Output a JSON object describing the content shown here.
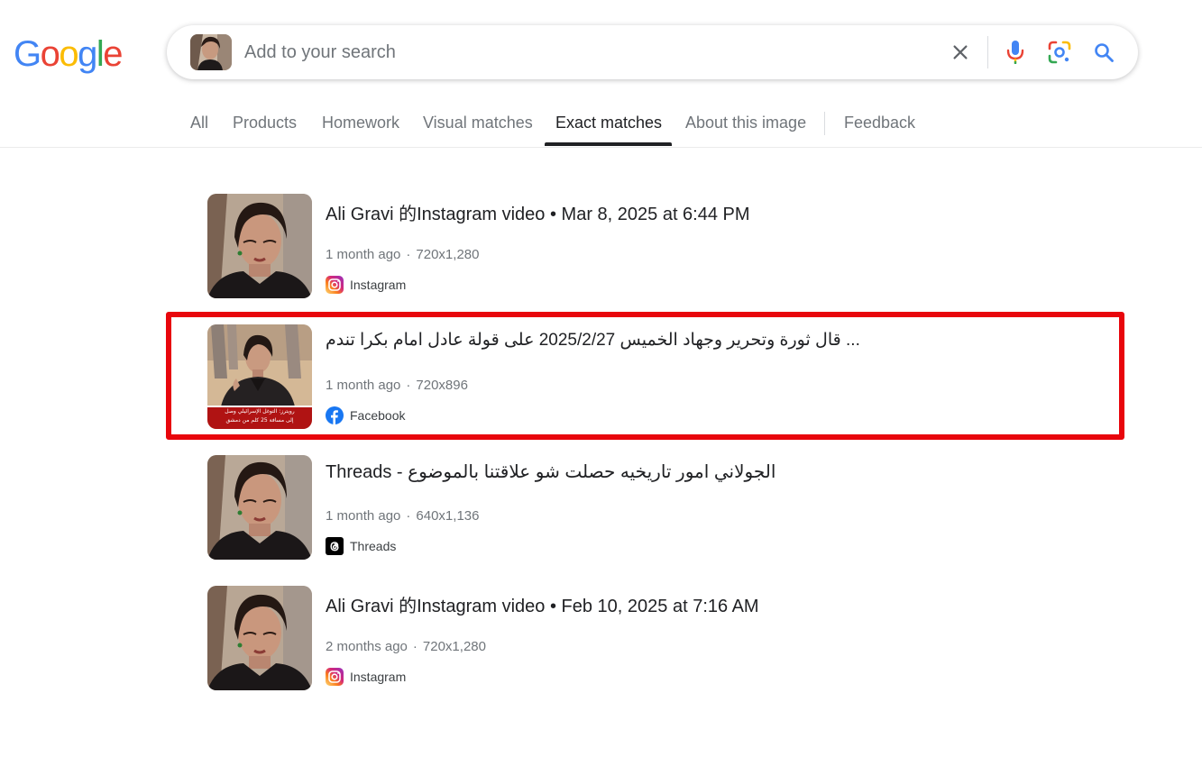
{
  "logo": {
    "letters": [
      "G",
      "o",
      "o",
      "g",
      "l",
      "e"
    ],
    "colors": [
      "#4285F4",
      "#EA4335",
      "#FBBC05",
      "#4285F4",
      "#34A853",
      "#EA4335"
    ]
  },
  "search": {
    "placeholder": "Add to your search",
    "value": ""
  },
  "tabs": [
    {
      "label": "All"
    },
    {
      "label": "Products"
    },
    {
      "label": "Homework"
    },
    {
      "label": "Visual matches"
    },
    {
      "label": "Exact matches",
      "active": true
    },
    {
      "label": "About this image"
    },
    {
      "label": "Feedback"
    }
  ],
  "results": [
    {
      "title": "Ali Gravi 的Instagram video • Mar 8, 2025 at 6:44 PM",
      "age": "1 month ago",
      "dimensions": "720x1,280",
      "source": "Instagram",
      "source_icon": "instagram-icon"
    },
    {
      "title": "قال ثورة وتحرير وجهاد الخميس 2025/2/27 على قولة عادل امام بكرا تندم ...",
      "age": "1 month ago",
      "dimensions": "720x896",
      "source": "Facebook",
      "source_icon": "facebook-icon",
      "highlighted": true,
      "thumb_caption_line1": "رويترز: التوغل الإسرائيلي وصل",
      "thumb_caption_line2": "إلى مسافة 25 كلم من دمشق"
    },
    {
      "title": "Threads - الجولاني امور تاريخيه حصلت شو علاقتنا بالموضوع",
      "age": "1 month ago",
      "dimensions": "640x1,136",
      "source": "Threads",
      "source_icon": "threads-icon"
    },
    {
      "title": "Ali Gravi 的Instagram video • Feb 10, 2025 at 7:16 AM",
      "age": "2 months ago",
      "dimensions": "720x1,280",
      "source": "Instagram",
      "source_icon": "instagram-icon"
    }
  ],
  "colors": {
    "highlight": "#e8060c",
    "facebook": "#1877F2",
    "search_icon": "#4285F4"
  }
}
